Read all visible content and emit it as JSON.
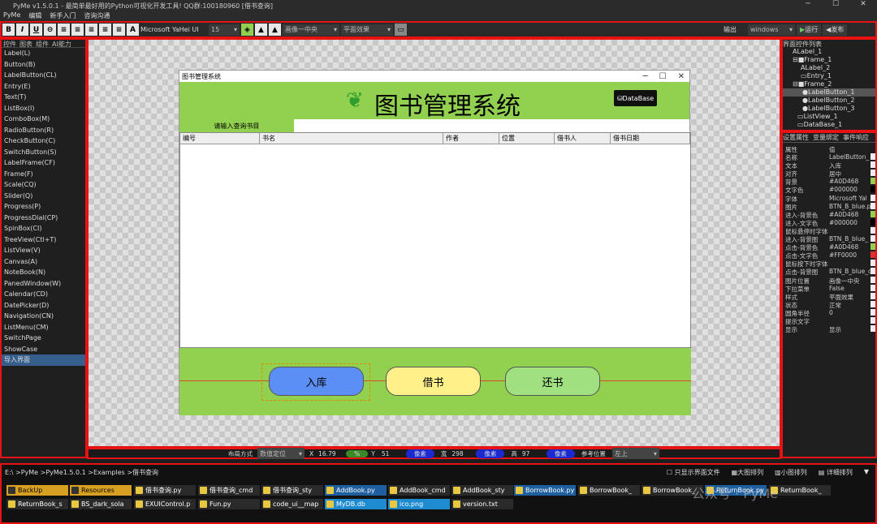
{
  "title": "PyMe v1.5.0.1 - 最简单最好用的Python可视化开发工具! QQ群:100180960    [借书查询]",
  "menu": [
    "PyMe",
    "编辑",
    "新手入门",
    "咨询沟通"
  ],
  "toolbar": {
    "font_name": "Microsoft YaHei UI",
    "font_size": "15",
    "image_pos": "画像一中央",
    "style": "平面效果",
    "output_label": "输出",
    "platform": "windows",
    "run": "运行",
    "publish": "发布"
  },
  "left_tabs": [
    "控件",
    "图表",
    "组件",
    "AI能力"
  ],
  "left_items": [
    "Label(L)",
    "Button(B)",
    "LabelButton(CL)",
    "Entry(E)",
    "Text(T)",
    "ListBox(I)",
    "ComboBox(M)",
    "RadioButton(R)",
    "CheckButton(C)",
    "SwitchButton(S)",
    "LabelFrame(CF)",
    "Frame(F)",
    "Scale(CQ)",
    "Slider(Q)",
    "Progress(P)",
    "ProgressDial(CP)",
    "SpinBox(CI)",
    "TreeView(Ctl+T)",
    "ListView(V)",
    "Canvas(A)",
    "NoteBook(N)",
    "PanedWindow(W)",
    "Calendar(CD)",
    "DatePicker(D)",
    "Navigation(CN)",
    "ListMenu(CM)",
    "SwitchPage",
    "ShowCase",
    "导入界面"
  ],
  "form": {
    "title": "图书管理系统",
    "banner": "图书管理系统",
    "db_button": "DataBase",
    "search_label": "请输入查询书目",
    "columns": [
      "编号",
      "书名",
      "作者",
      "位置",
      "借书人",
      "借书日期"
    ],
    "buttons": [
      "入库",
      "借书",
      "还书"
    ]
  },
  "tree_title": "界面控件列表",
  "tree": [
    "Label_1",
    "Frame_1",
    "Label_2",
    "Entry_1",
    "Frame_2",
    "LabelButton_1",
    "LabelButton_2",
    "LabelButton_3",
    "ListView_1",
    "DataBase_1"
  ],
  "prop_tabs": [
    "设置属性",
    "变量绑定",
    "事件响应"
  ],
  "props": [
    [
      "属性",
      "值"
    ],
    [
      "名称",
      "LabelButton_"
    ],
    [
      "文本",
      "入库"
    ],
    [
      "对齐",
      "居中"
    ],
    [
      "背景",
      "#A0D468"
    ],
    [
      "文字色",
      "#000000"
    ],
    [
      "字体",
      "Microsoft Yal"
    ],
    [
      "图片",
      "BTN_B_blue.p"
    ],
    [
      "进入-背景色",
      "#A0D468"
    ],
    [
      "进入-文字色",
      "#000000"
    ],
    [
      "鼠标悬停时字体",
      ""
    ],
    [
      "进入-背景图",
      "BTN_B_blue_"
    ],
    [
      "点击-背景色",
      "#A0D468"
    ],
    [
      "点击-文字色",
      "#FF0000"
    ],
    [
      "鼠标按下时字体",
      ""
    ],
    [
      "点击-背景图",
      "BTN_B_blue_c"
    ],
    [
      "图片位置",
      "画像一中央"
    ],
    [
      "下拉菜单",
      "False"
    ],
    [
      "样式",
      "平面效果"
    ],
    [
      "状态",
      "正常"
    ],
    [
      "圆角半径",
      "0"
    ],
    [
      "提示文字",
      ""
    ],
    [
      "显示",
      "显示"
    ]
  ],
  "status": {
    "layout": "布局方式",
    "layout_val": "数值定位",
    "x": "X",
    "x_val": "16.79",
    "pct": "%",
    "y": "Y",
    "y_val": "51",
    "px1": "像素",
    "w": "宽",
    "w_val": "298",
    "px2": "像素",
    "h": "高",
    "h_val": "97",
    "px3": "像素",
    "ref": "参考位置",
    "ref_val": "左上"
  },
  "path": "E:\\ >PyMe >PyMe1.5.0.1 >Examples >借书查询",
  "view_opts": [
    "只显示界面文件",
    "大图排列",
    "小图排列",
    "详细排列"
  ],
  "files_row1": [
    "BackUp",
    "Resources",
    "借书查询.py",
    "借书查询_cmd",
    "借书查询_sty",
    "AddBook.py",
    "AddBook_cmd",
    "AddBook_sty",
    "BorrowBook.py",
    "BorrowBook_",
    "BorrowBook_",
    "ReturnBook.py",
    "ReturnBook_"
  ],
  "files_row2": [
    "ReturnBook_s",
    "BS_dark_sola",
    "EXUIControl.p",
    "Fun.py",
    "code_ui__map",
    "MyDB.db",
    "ico.png",
    "version.txt"
  ],
  "watermark": "公众号 · PyMe"
}
